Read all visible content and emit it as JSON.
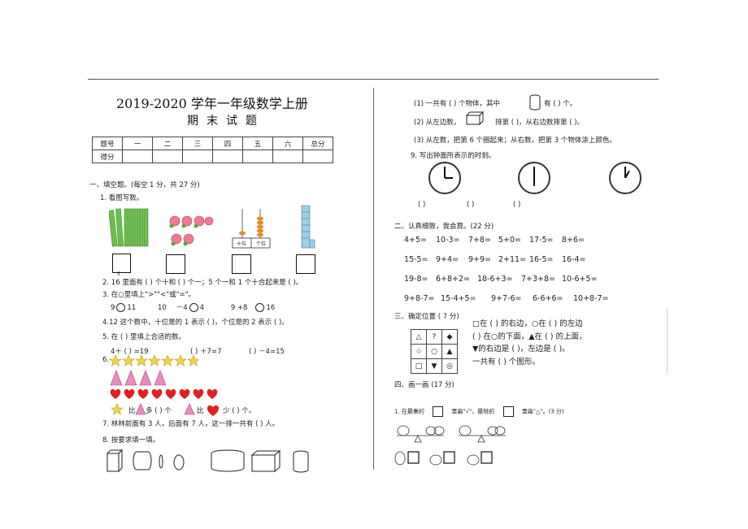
{
  "header": {
    "title": "2019-2020 学年一年级数学上册",
    "subtitle": "期末试题"
  },
  "score_table": {
    "row1": [
      "题号",
      "一",
      "二",
      "三",
      "四",
      "五",
      "六",
      "总分"
    ],
    "row2": [
      "得分",
      "",
      "",
      "",
      "",
      "",
      "",
      ""
    ]
  },
  "left": {
    "section1": "一、填空题。(每空  1 分，共  27 分)",
    "q1": "1.  看图写数。",
    "abacus_labels": [
      "十位",
      "个位"
    ],
    "q2": "2.  16  里面有 (     ) 个十和 (     ) 个一；5 个一和  1 个十合起来是 (     )。",
    "q3": "3.  在○里填上\">\"\"<\"或\"=\"。",
    "q3_items": [
      "9",
      "11",
      "10",
      "－4",
      "4",
      "9 +8",
      "16"
    ],
    "q4": "4.12  这个数中，十位是的   1 表示 (          )，个位是的  2 表示 (          )。",
    "q5": "5. 在 (     ) 里填上合适的数。",
    "q5_items": [
      "4＋ (        ) =19",
      "(        ) ＋7=7",
      "(        ) －4=15"
    ],
    "q6": "6.",
    "q6_compare": [
      "比",
      "多 (    ) 个",
      "比",
      "少 (    ) 个。"
    ],
    "q7": "7. 林林前面有  3 人，后面有  7 人，这一排一共有 (          ) 人。",
    "q8": "8. 按要求填一填。",
    "small_dot": "5"
  },
  "right": {
    "r1": "(1)      一共有 (          ) 个物体，其中",
    "r1b": "有 (          ) 个。",
    "r2": "(2) 从左边数，",
    "r2b": "排第 (          )，从右边数排第 (          )。",
    "r3": "(3) 从左数，把第  6 个圈起来；从右数，把第  3 个物体涂上颜色。",
    "q9": "9. 写出钟面所表示的时刻。",
    "q9_blanks": [
      "(          )",
      "(          )",
      "(          )"
    ],
    "section2": "二、认真细致，我会算。(22 分)",
    "calc": [
      [
        "4+5=",
        "10-3=",
        "7+8=",
        "5+0=",
        "17-5=",
        "8+6="
      ],
      [
        "15-5=",
        "9+4=",
        "9+9=",
        "2+11=",
        "16-5=",
        "16-4="
      ],
      [
        "19-8=",
        "6+8+2=",
        "18-6+3=",
        "7+3+8=",
        "10-6+5="
      ],
      [
        "9+8-7=",
        "15-4+5=",
        "9+7-6=",
        "6-6+6=",
        "10+8-7="
      ]
    ],
    "section3": "三、确定位置 (  7 分)",
    "grid": [
      [
        "△",
        "?",
        "◆"
      ],
      [
        "☆",
        "○",
        "▲"
      ],
      [
        "□",
        "▼",
        "◎"
      ]
    ],
    "pos1": "□在 (      ) 的右边，○在 (      ) 的左边",
    "pos2": "(      ) 在○的下面，▲在 (      ) 的上面，",
    "pos3": "▼的右边是 (      )，左边是 (      )。",
    "pos4": "一共有 (      ) 个图形。",
    "section4": "四、画一画 (17 分)",
    "draw1": "1. 在最重的",
    "draw1b": "里画\"√\"，最轻的",
    "draw1c": "里画\"△\"。(3  分)"
  }
}
